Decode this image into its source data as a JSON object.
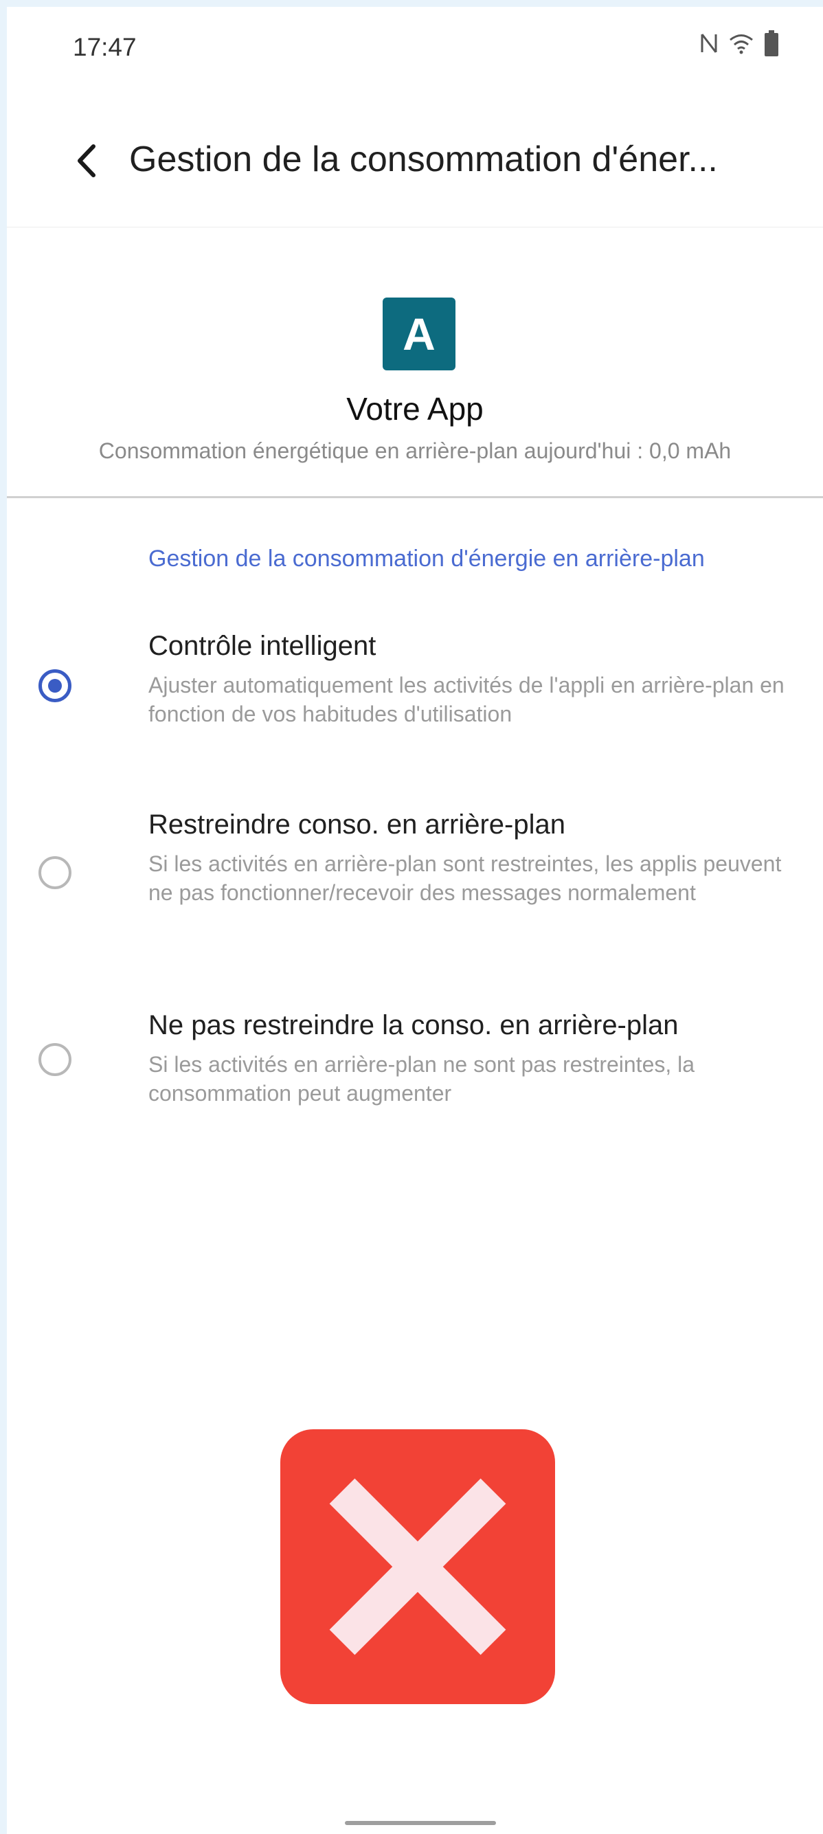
{
  "status_bar": {
    "time": "17:47",
    "icons": [
      "nfc-icon",
      "wifi-icon",
      "battery-icon"
    ]
  },
  "app_bar": {
    "back_icon": "chevron-left-icon",
    "title": "Gestion de la consommation d'éner..."
  },
  "app_info": {
    "icon_letter": "A",
    "icon_color": "#0d6b7f",
    "name": "Votre App",
    "usage": "Consommation énergétique en arrière-plan aujourd'hui : 0,0 mAh"
  },
  "section": {
    "header": "Gestion de la consommation d'énergie en arrière-plan",
    "accent_color": "#4a6bd1"
  },
  "options": [
    {
      "title": "Contrôle intelligent",
      "description": "Ajuster automatiquement les activités de l'appli en arrière-plan en fonction de vos habitudes d'utilisation",
      "selected": true
    },
    {
      "title": "Restreindre conso. en arrière-plan",
      "description": "Si les activités en arrière-plan sont restreintes, les applis peuvent ne pas fonctionner/recevoir des messages normalement",
      "selected": false
    },
    {
      "title": "Ne pas restreindre la conso. en arrière-plan",
      "description": "Si les activités en arrière-plan ne sont pas restreintes, la consommation peut augmenter",
      "selected": false
    }
  ],
  "overlay": {
    "icon": "close-icon",
    "color": "#f24236"
  }
}
